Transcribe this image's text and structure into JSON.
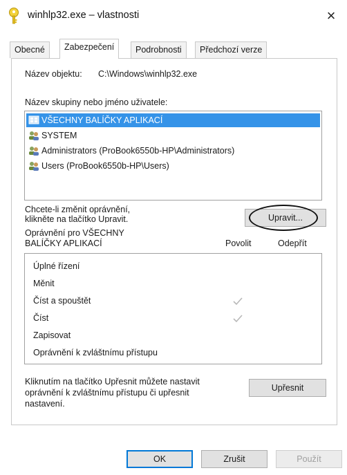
{
  "window": {
    "title": "winhlp32.exe – vlastnosti",
    "close_glyph": "×",
    "icon": "key-icon"
  },
  "tabs": [
    {
      "label": "Obecné",
      "active": false
    },
    {
      "label": "Zabezpečení",
      "active": true
    },
    {
      "label": "Podrobnosti",
      "active": false
    },
    {
      "label": "Předchozí verze",
      "active": false
    }
  ],
  "object": {
    "label": "Název objektu:",
    "value": "C:\\Windows\\winhlp32.exe"
  },
  "groups": {
    "label": "Název skupiny nebo jméno uživatele:",
    "items": [
      {
        "name": "VŠECHNY BALÍČKY APLIKACÍ",
        "selected": true,
        "icon": "app-packages-icon"
      },
      {
        "name": "SYSTEM",
        "selected": false,
        "icon": "users-icon"
      },
      {
        "name": "Administrators (ProBook6550b-HP\\Administrators)",
        "selected": false,
        "icon": "users-icon"
      },
      {
        "name": "Users (ProBook6550b-HP\\Users)",
        "selected": false,
        "icon": "users-icon"
      }
    ]
  },
  "change_hint": {
    "line1": "Chcete-li změnit oprávnění,",
    "line2": "klikněte na tlačítko Upravit."
  },
  "edit_button": "Upravit...",
  "permissions": {
    "header_line1": "Oprávnění pro VŠECHNY",
    "header_line2": "BALÍČKY APLIKACÍ",
    "col_allow": "Povolit",
    "col_deny": "Odepřít",
    "rows": [
      {
        "name": "Úplné řízení",
        "allow": false,
        "deny": false
      },
      {
        "name": "Měnit",
        "allow": false,
        "deny": false
      },
      {
        "name": "Číst a spouštět",
        "allow": true,
        "deny": false
      },
      {
        "name": "Číst",
        "allow": true,
        "deny": false
      },
      {
        "name": "Zapisovat",
        "allow": false,
        "deny": false
      },
      {
        "name": "Oprávnění k zvláštnímu přístupu",
        "allow": false,
        "deny": false
      }
    ]
  },
  "advanced_hint": {
    "line1": "Kliknutím na tlačítko Upřesnit můžete nastavit",
    "line2": "oprávnění k zvláštnímu přístupu či upřesnit",
    "line3": "nastavení."
  },
  "advanced_button": "Upřesnit",
  "footer": {
    "ok": "OK",
    "cancel": "Zrušit",
    "apply": "Použít"
  },
  "colors": {
    "selection": "#3593e8",
    "check": "#b8b8b8",
    "default_button_border": "#0078d7"
  }
}
